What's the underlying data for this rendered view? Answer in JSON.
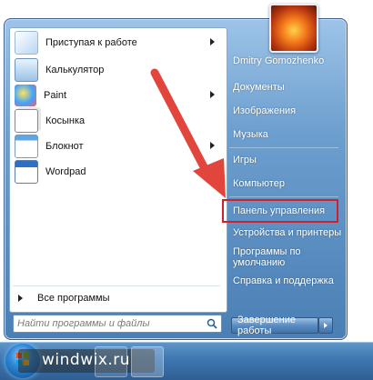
{
  "pinned_programs": [
    {
      "label": "Приступая к работе",
      "icon": "getting-started-icon",
      "has_submenu": true
    },
    {
      "label": "Калькулятор",
      "icon": "calculator-icon",
      "has_submenu": false
    },
    {
      "label": "Paint",
      "icon": "paint-icon",
      "has_submenu": true
    },
    {
      "label": "Косынка",
      "icon": "solitaire-icon",
      "has_submenu": false
    },
    {
      "label": "Блокнот",
      "icon": "notepad-icon",
      "has_submenu": true
    },
    {
      "label": "Wordpad",
      "icon": "wordpad-icon",
      "has_submenu": false
    }
  ],
  "all_programs_label": "Все программы",
  "search": {
    "placeholder": "Найти программы и файлы"
  },
  "right_items": [
    {
      "label": "Dmitry Gomozhenko"
    },
    {
      "label": "Документы"
    },
    {
      "label": "Изображения"
    },
    {
      "label": "Музыка"
    },
    {
      "label": "Игры"
    },
    {
      "label": "Компьютер"
    },
    {
      "label": "Панель управления"
    },
    {
      "label": "Устройства и принтеры"
    },
    {
      "label": "Программы по умолчанию"
    },
    {
      "label": "Справка и поддержка"
    }
  ],
  "shutdown_label": "Завершение работы",
  "watermark": "windwix.ru",
  "colors": {
    "highlight": "#d01f2e",
    "arrow": "#e2453c",
    "accent": "#4a7fb5"
  }
}
